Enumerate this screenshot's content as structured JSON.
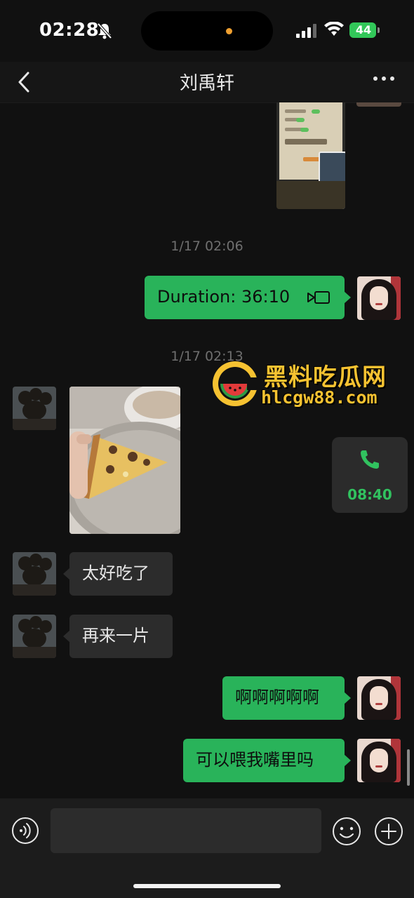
{
  "status_bar": {
    "time": "02:28",
    "battery": "44",
    "icons": [
      "bell-slash-icon",
      "signal-icon",
      "wifi-icon",
      "battery-icon"
    ]
  },
  "nav": {
    "title": "刘禹轩",
    "back_icon": "chevron-left-icon",
    "more_icon": "more-dots-icon"
  },
  "messages": {
    "ts1": "1/17 02:06",
    "video_call": "Duration: 36:10",
    "ts2": "1/17 02:13",
    "call_duration": "08:40",
    "m1": "太好吃了",
    "m2": "再来一片",
    "m3": "啊啊啊啊啊",
    "m4": "可以喂我嘴里吗"
  },
  "watermark": {
    "title": "黑料吃瓜网",
    "url": "hlcgw88.com"
  },
  "input_bar": {
    "placeholder": "",
    "icons": [
      "voice-icon",
      "emoji-icon",
      "plus-icon"
    ]
  },
  "colors": {
    "background": "#111111",
    "bubble_me": "#29b35a",
    "bubble_other": "#2c2c2c",
    "watermark": "#f6c231"
  }
}
